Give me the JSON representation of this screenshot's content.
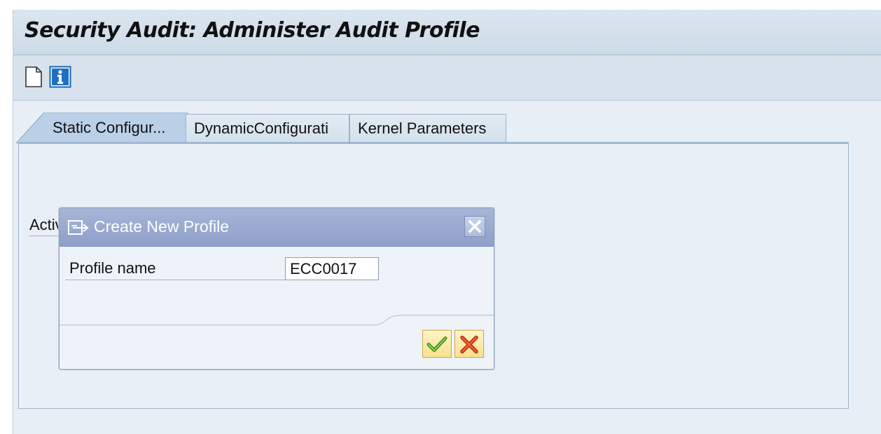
{
  "window": {
    "title": "Security Audit: Administer Audit Profile"
  },
  "toolbar": {
    "icons": [
      "new-document-icon",
      "info-icon"
    ]
  },
  "tabs": [
    {
      "label": "Static Configur...",
      "active": true
    },
    {
      "label": "DynamicConfigurati",
      "active": false
    },
    {
      "label": "Kernel Parameters",
      "active": false
    }
  ],
  "content": {
    "partial_label": "Activ"
  },
  "dialog": {
    "title": "Create New Profile",
    "field_label": "Profile name",
    "field_value": "ECC0017",
    "ok_icon": "checkmark-icon",
    "cancel_icon": "cancel-x-icon"
  },
  "colors": {
    "dialog_header": "#96a5cf",
    "active_tab": "#bad0e7",
    "button_bg": "#fbe8a4"
  }
}
